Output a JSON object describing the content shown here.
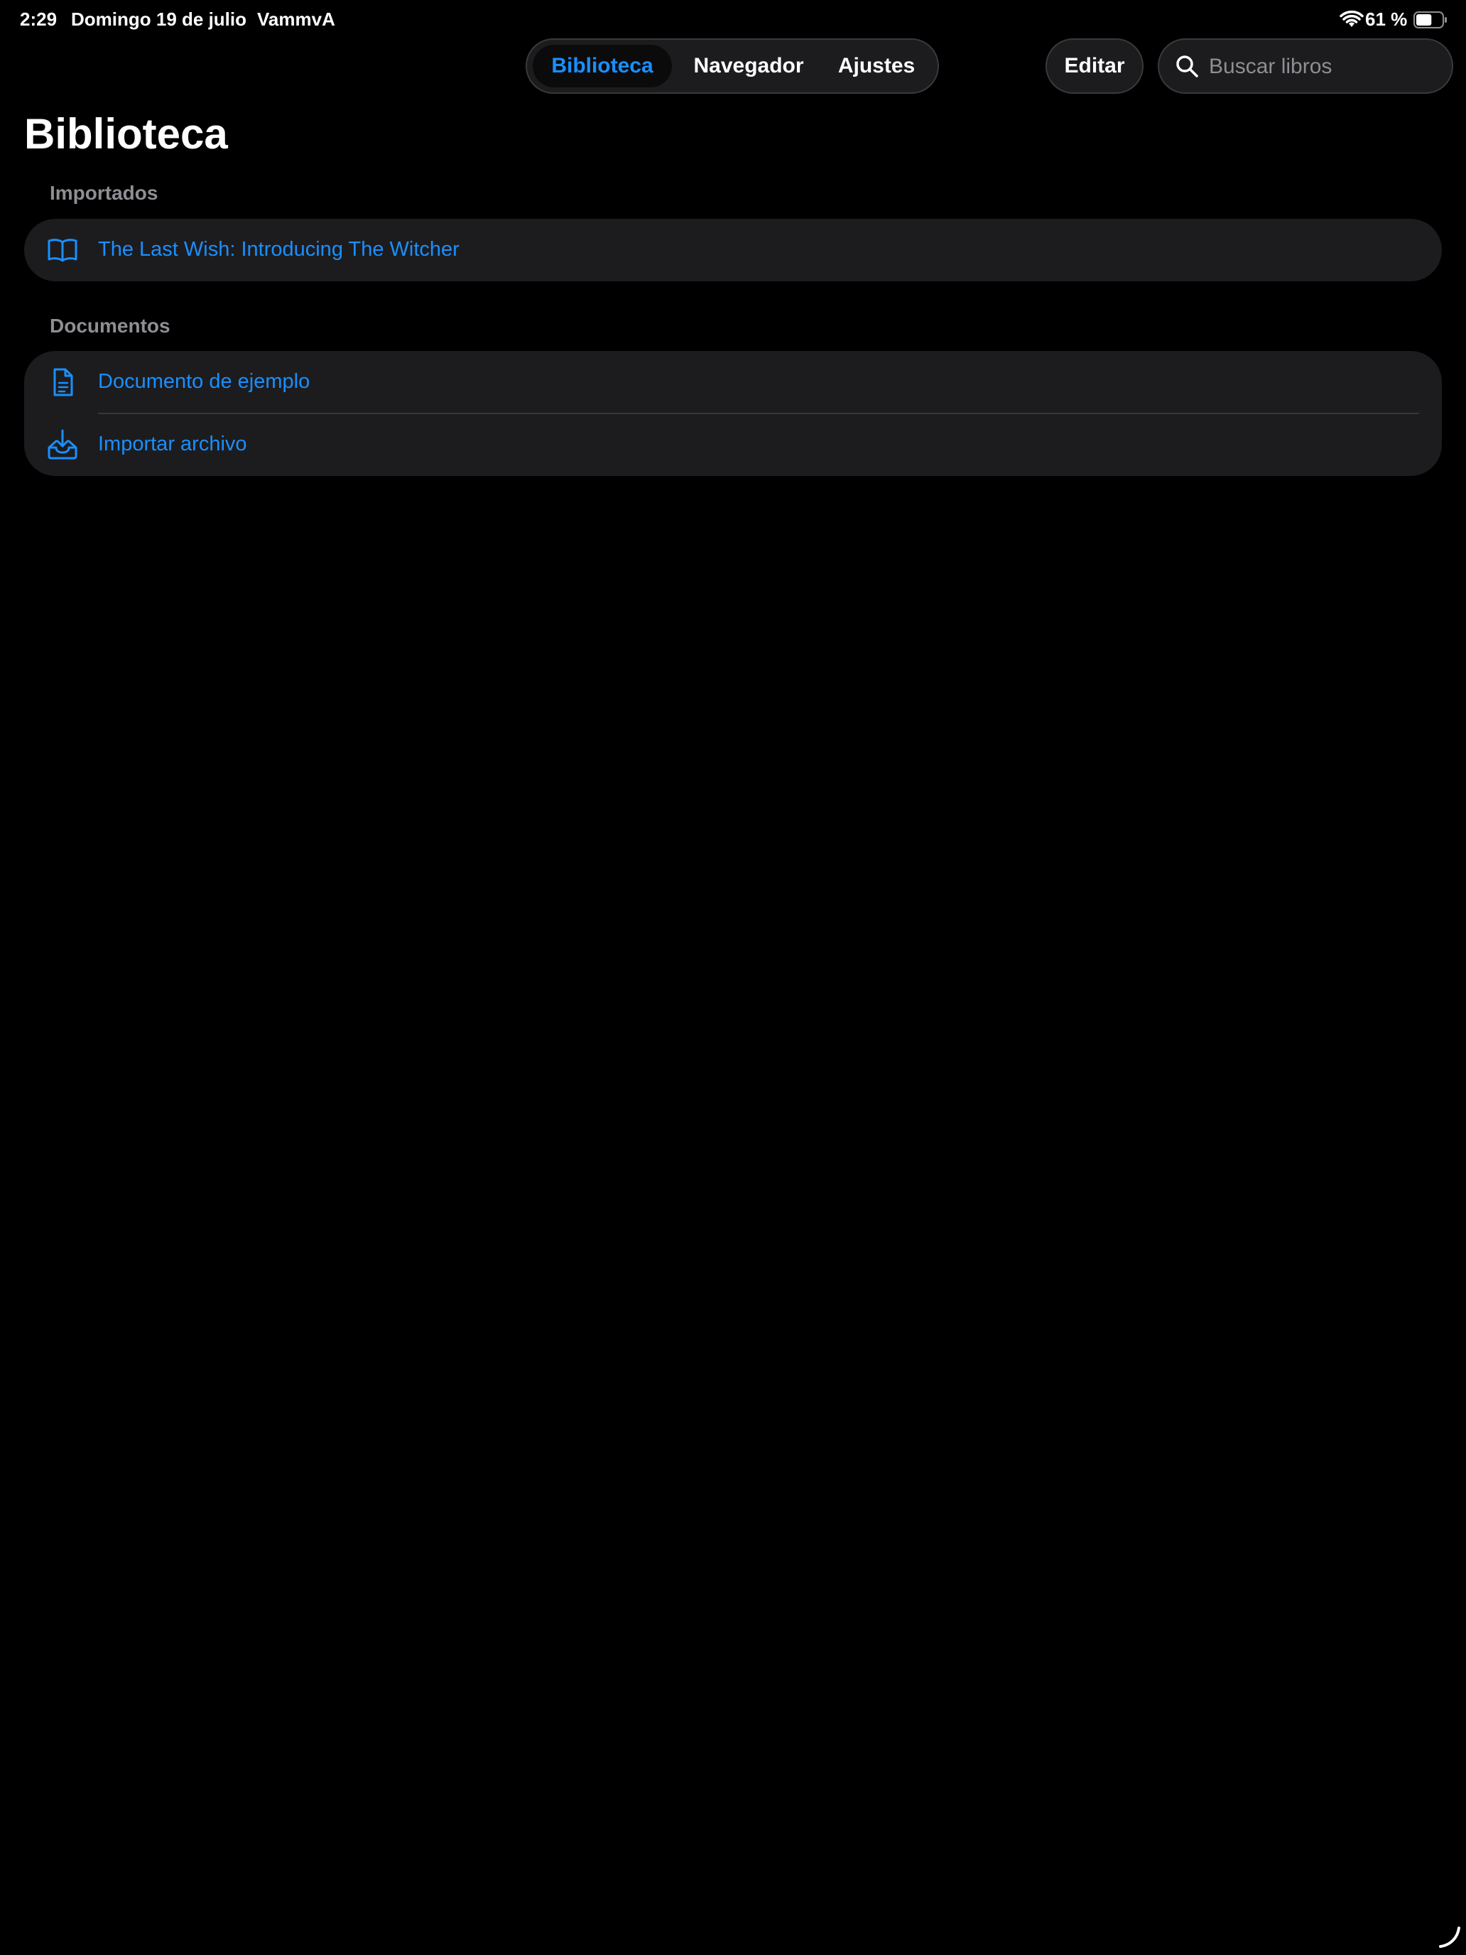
{
  "status_bar": {
    "time": "2:29",
    "date": "Domingo 19 de julio",
    "app": "VammvA",
    "battery_percent": "61 %",
    "battery_level": 0.61
  },
  "tabs": [
    {
      "label": "Biblioteca",
      "active": true
    },
    {
      "label": "Navegador",
      "active": false
    },
    {
      "label": "Ajustes",
      "active": false
    }
  ],
  "toolbar": {
    "edit_label": "Editar",
    "search_placeholder": "Buscar libros",
    "search_value": ""
  },
  "page_title": "Biblioteca",
  "sections": [
    {
      "header": "Importados",
      "items": [
        {
          "label": "The Last Wish: Introducing The Witcher",
          "icon": "book-icon"
        }
      ]
    },
    {
      "header": "Documentos",
      "items": [
        {
          "label": "Documento de ejemplo",
          "icon": "document-icon"
        },
        {
          "label": "Importar archivo",
          "icon": "import-tray-icon"
        }
      ]
    }
  ],
  "colors": {
    "background": "#000000",
    "surface": "#1c1c1e",
    "accent": "#1a8fff",
    "secondary_text": "#8e8e93"
  }
}
